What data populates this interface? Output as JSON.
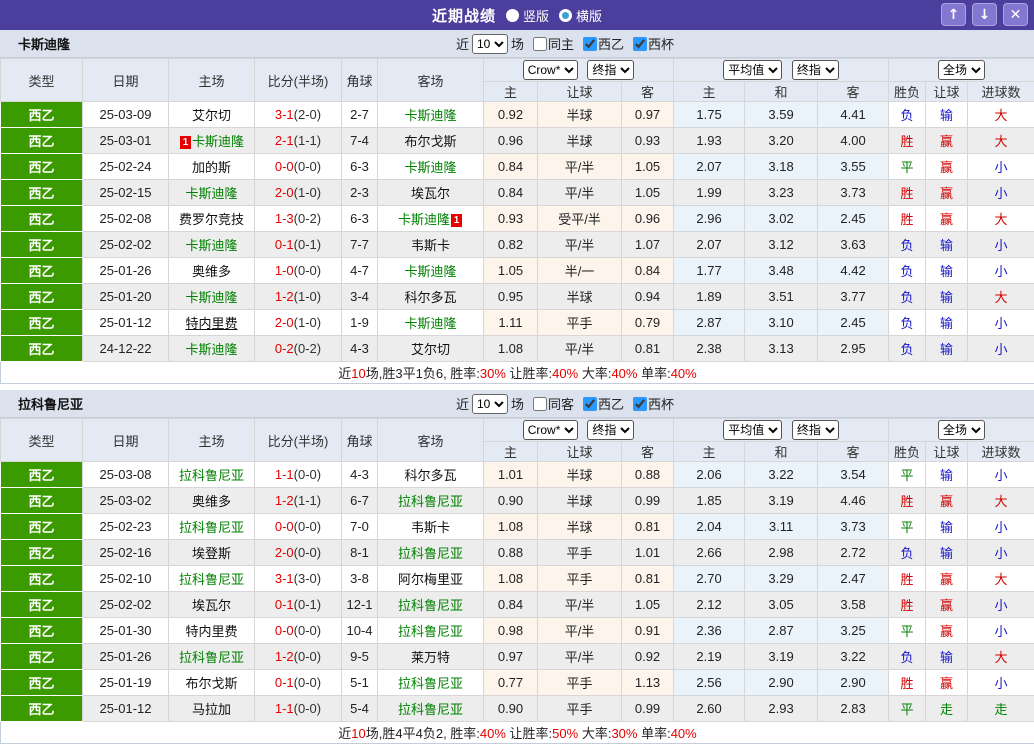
{
  "titlebar": {
    "title": "近期战绩",
    "vertical_label": "竖版",
    "horizontal_label": "横版",
    "vertical_selected": true,
    "up_glyph": "↑",
    "down_glyph": "↓",
    "close_glyph": "✕"
  },
  "colors": {
    "titlebar_purple": "#4b3e9c",
    "league_green": "#3a9a00",
    "team_green": "#008000",
    "score_red": "#e60000",
    "win_red": "#d00000",
    "lose_blue": "#1414c8",
    "draw_green": "#008000",
    "odds_bg": "#fdf5ec",
    "avg_bg": "#e9f3f9"
  },
  "columns": {
    "type": "类型",
    "date": "日期",
    "home": "主场",
    "score": "比分(半场)",
    "corner": "角球",
    "away": "客场",
    "crow_select": "Crow*",
    "final_select": "终指",
    "avg_select": "平均值",
    "final_select2": "终指",
    "full_select": "全场",
    "h": "主",
    "handicap": "让球",
    "a": "客",
    "avg_h": "主",
    "avg_d": "和",
    "avg_a": "客",
    "wl": "胜负",
    "hcap_res": "让球",
    "goals": "进球数"
  },
  "sections": [
    {
      "team": "卡斯迪隆",
      "filter": {
        "near": "近",
        "count": "10",
        "games": "场",
        "same": "同主",
        "same_checked": false,
        "league": "西乙",
        "league_checked": true,
        "cup": "西杯",
        "cup_checked": true
      },
      "rows": [
        {
          "league": "西乙",
          "date": "25-03-09",
          "home": {
            "name": "艾尔切"
          },
          "score": "3-1",
          "half": "(2-0)",
          "corner": "2-7",
          "away": {
            "name": "卡斯迪隆",
            "green": true
          },
          "odds": [
            "0.92",
            "半球",
            "0.97"
          ],
          "avg": [
            "1.75",
            "3.59",
            "4.41"
          ],
          "results": [
            [
              "负",
              "b"
            ],
            [
              "输",
              "b"
            ],
            [
              "大",
              "r"
            ]
          ]
        },
        {
          "league": "西乙",
          "date": "25-03-01",
          "home": {
            "name": "卡斯迪隆",
            "green": true,
            "badge": "1",
            "badge_pos": "before"
          },
          "score": "2-1",
          "half": "(1-1)",
          "corner": "7-4",
          "away": {
            "name": "布尔戈斯"
          },
          "odds": [
            "0.96",
            "半球",
            "0.93"
          ],
          "avg": [
            "1.93",
            "3.20",
            "4.00"
          ],
          "results": [
            [
              "胜",
              "r"
            ],
            [
              "赢",
              "r"
            ],
            [
              "大",
              "r"
            ]
          ]
        },
        {
          "league": "西乙",
          "date": "25-02-24",
          "home": {
            "name": "加的斯"
          },
          "score": "0-0",
          "half": "(0-0)",
          "corner": "6-3",
          "away": {
            "name": "卡斯迪隆",
            "green": true
          },
          "odds": [
            "0.84",
            "平/半",
            "1.05"
          ],
          "avg": [
            "2.07",
            "3.18",
            "3.55"
          ],
          "results": [
            [
              "平",
              "g"
            ],
            [
              "赢",
              "r"
            ],
            [
              "小",
              "b"
            ]
          ]
        },
        {
          "league": "西乙",
          "date": "25-02-15",
          "home": {
            "name": "卡斯迪隆",
            "green": true
          },
          "score": "2-0",
          "half": "(1-0)",
          "corner": "2-3",
          "away": {
            "name": "埃瓦尔"
          },
          "odds": [
            "0.84",
            "平/半",
            "1.05"
          ],
          "avg": [
            "1.99",
            "3.23",
            "3.73"
          ],
          "results": [
            [
              "胜",
              "r"
            ],
            [
              "赢",
              "r"
            ],
            [
              "小",
              "b"
            ]
          ]
        },
        {
          "league": "西乙",
          "date": "25-02-08",
          "home": {
            "name": "费罗尔竞技"
          },
          "score": "1-3",
          "half": "(0-2)",
          "corner": "6-3",
          "away": {
            "name": "卡斯迪隆",
            "green": true,
            "badge": "1",
            "badge_pos": "after"
          },
          "odds": [
            "0.93",
            "受平/半",
            "0.96"
          ],
          "avg": [
            "2.96",
            "3.02",
            "2.45"
          ],
          "results": [
            [
              "胜",
              "r"
            ],
            [
              "赢",
              "r"
            ],
            [
              "大",
              "r"
            ]
          ]
        },
        {
          "league": "西乙",
          "date": "25-02-02",
          "home": {
            "name": "卡斯迪隆",
            "green": true
          },
          "score": "0-1",
          "half": "(0-1)",
          "corner": "7-7",
          "away": {
            "name": "韦斯卡"
          },
          "odds": [
            "0.82",
            "平/半",
            "1.07"
          ],
          "avg": [
            "2.07",
            "3.12",
            "3.63"
          ],
          "results": [
            [
              "负",
              "b"
            ],
            [
              "输",
              "b"
            ],
            [
              "小",
              "b"
            ]
          ]
        },
        {
          "league": "西乙",
          "date": "25-01-26",
          "home": {
            "name": "奥维多"
          },
          "score": "1-0",
          "half": "(0-0)",
          "corner": "4-7",
          "away": {
            "name": "卡斯迪隆",
            "green": true
          },
          "odds": [
            "1.05",
            "半/一",
            "0.84"
          ],
          "avg": [
            "1.77",
            "3.48",
            "4.42"
          ],
          "results": [
            [
              "负",
              "b"
            ],
            [
              "输",
              "b"
            ],
            [
              "小",
              "b"
            ]
          ]
        },
        {
          "league": "西乙",
          "date": "25-01-20",
          "home": {
            "name": "卡斯迪隆",
            "green": true
          },
          "score": "1-2",
          "half": "(1-0)",
          "corner": "3-4",
          "away": {
            "name": "科尔多瓦"
          },
          "odds": [
            "0.95",
            "半球",
            "0.94"
          ],
          "avg": [
            "1.89",
            "3.51",
            "3.77"
          ],
          "results": [
            [
              "负",
              "b"
            ],
            [
              "输",
              "b"
            ],
            [
              "大",
              "r"
            ]
          ]
        },
        {
          "league": "西乙",
          "date": "25-01-12",
          "home": {
            "name": "特内里费",
            "underline": true
          },
          "score": "2-0",
          "half": "(1-0)",
          "corner": "1-9",
          "away": {
            "name": "卡斯迪隆",
            "green": true
          },
          "odds": [
            "1.11",
            "平手",
            "0.79"
          ],
          "avg": [
            "2.87",
            "3.10",
            "2.45"
          ],
          "results": [
            [
              "负",
              "b"
            ],
            [
              "输",
              "b"
            ],
            [
              "小",
              "b"
            ]
          ]
        },
        {
          "league": "西乙",
          "date": "24-12-22",
          "home": {
            "name": "卡斯迪隆",
            "green": true
          },
          "score": "0-2",
          "half": "(0-2)",
          "corner": "4-3",
          "away": {
            "name": "艾尔切"
          },
          "odds": [
            "1.08",
            "平/半",
            "0.81"
          ],
          "avg": [
            "2.38",
            "3.13",
            "2.95"
          ],
          "results": [
            [
              "负",
              "b"
            ],
            [
              "输",
              "b"
            ],
            [
              "小",
              "b"
            ]
          ]
        }
      ],
      "summary": [
        {
          "t": "近"
        },
        {
          "t": "10",
          "r": true
        },
        {
          "t": "场,胜3平1负6, 胜率:"
        },
        {
          "t": "30%",
          "r": true
        },
        {
          "t": " 让胜率:"
        },
        {
          "t": "40%",
          "r": true
        },
        {
          "t": " 大率:"
        },
        {
          "t": "40%",
          "r": true
        },
        {
          "t": " 单率:"
        },
        {
          "t": "40%",
          "r": true
        }
      ]
    },
    {
      "team": "拉科鲁尼亚",
      "filter": {
        "near": "近",
        "count": "10",
        "games": "场",
        "same": "同客",
        "same_checked": false,
        "league": "西乙",
        "league_checked": true,
        "cup": "西杯",
        "cup_checked": true
      },
      "rows": [
        {
          "league": "西乙",
          "date": "25-03-08",
          "home": {
            "name": "拉科鲁尼亚",
            "green": true
          },
          "score": "1-1",
          "half": "(0-0)",
          "corner": "4-3",
          "away": {
            "name": "科尔多瓦"
          },
          "odds": [
            "1.01",
            "半球",
            "0.88"
          ],
          "avg": [
            "2.06",
            "3.22",
            "3.54"
          ],
          "results": [
            [
              "平",
              "g"
            ],
            [
              "输",
              "b"
            ],
            [
              "小",
              "b"
            ]
          ]
        },
        {
          "league": "西乙",
          "date": "25-03-02",
          "home": {
            "name": "奥维多"
          },
          "score": "1-2",
          "half": "(1-1)",
          "corner": "6-7",
          "away": {
            "name": "拉科鲁尼亚",
            "green": true
          },
          "odds": [
            "0.90",
            "半球",
            "0.99"
          ],
          "avg": [
            "1.85",
            "3.19",
            "4.46"
          ],
          "results": [
            [
              "胜",
              "r"
            ],
            [
              "赢",
              "r"
            ],
            [
              "大",
              "r"
            ]
          ]
        },
        {
          "league": "西乙",
          "date": "25-02-23",
          "home": {
            "name": "拉科鲁尼亚",
            "green": true
          },
          "score": "0-0",
          "half": "(0-0)",
          "corner": "7-0",
          "away": {
            "name": "韦斯卡"
          },
          "odds": [
            "1.08",
            "半球",
            "0.81"
          ],
          "avg": [
            "2.04",
            "3.11",
            "3.73"
          ],
          "results": [
            [
              "平",
              "g"
            ],
            [
              "输",
              "b"
            ],
            [
              "小",
              "b"
            ]
          ]
        },
        {
          "league": "西乙",
          "date": "25-02-16",
          "home": {
            "name": "埃登斯"
          },
          "score": "2-0",
          "half": "(0-0)",
          "corner": "8-1",
          "away": {
            "name": "拉科鲁尼亚",
            "green": true
          },
          "odds": [
            "0.88",
            "平手",
            "1.01"
          ],
          "avg": [
            "2.66",
            "2.98",
            "2.72"
          ],
          "results": [
            [
              "负",
              "b"
            ],
            [
              "输",
              "b"
            ],
            [
              "小",
              "b"
            ]
          ]
        },
        {
          "league": "西乙",
          "date": "25-02-10",
          "home": {
            "name": "拉科鲁尼亚",
            "green": true
          },
          "score": "3-1",
          "half": "(3-0)",
          "corner": "3-8",
          "away": {
            "name": "阿尔梅里亚"
          },
          "odds": [
            "1.08",
            "平手",
            "0.81"
          ],
          "avg": [
            "2.70",
            "3.29",
            "2.47"
          ],
          "results": [
            [
              "胜",
              "r"
            ],
            [
              "赢",
              "r"
            ],
            [
              "大",
              "r"
            ]
          ]
        },
        {
          "league": "西乙",
          "date": "25-02-02",
          "home": {
            "name": "埃瓦尔"
          },
          "score": "0-1",
          "half": "(0-1)",
          "corner": "12-1",
          "away": {
            "name": "拉科鲁尼亚",
            "green": true
          },
          "odds": [
            "0.84",
            "平/半",
            "1.05"
          ],
          "avg": [
            "2.12",
            "3.05",
            "3.58"
          ],
          "results": [
            [
              "胜",
              "r"
            ],
            [
              "赢",
              "r"
            ],
            [
              "小",
              "b"
            ]
          ]
        },
        {
          "league": "西乙",
          "date": "25-01-30",
          "home": {
            "name": "特内里费"
          },
          "score": "0-0",
          "half": "(0-0)",
          "corner": "10-4",
          "away": {
            "name": "拉科鲁尼亚",
            "green": true
          },
          "odds": [
            "0.98",
            "平/半",
            "0.91"
          ],
          "avg": [
            "2.36",
            "2.87",
            "3.25"
          ],
          "results": [
            [
              "平",
              "g"
            ],
            [
              "赢",
              "r"
            ],
            [
              "小",
              "b"
            ]
          ]
        },
        {
          "league": "西乙",
          "date": "25-01-26",
          "home": {
            "name": "拉科鲁尼亚",
            "green": true
          },
          "score": "1-2",
          "half": "(0-0)",
          "corner": "9-5",
          "away": {
            "name": "莱万特"
          },
          "odds": [
            "0.97",
            "平/半",
            "0.92"
          ],
          "avg": [
            "2.19",
            "3.19",
            "3.22"
          ],
          "results": [
            [
              "负",
              "b"
            ],
            [
              "输",
              "b"
            ],
            [
              "大",
              "r"
            ]
          ]
        },
        {
          "league": "西乙",
          "date": "25-01-19",
          "home": {
            "name": "布尔戈斯"
          },
          "score": "0-1",
          "half": "(0-0)",
          "corner": "5-1",
          "away": {
            "name": "拉科鲁尼亚",
            "green": true
          },
          "odds": [
            "0.77",
            "平手",
            "1.13"
          ],
          "avg": [
            "2.56",
            "2.90",
            "2.90"
          ],
          "results": [
            [
              "胜",
              "r"
            ],
            [
              "赢",
              "r"
            ],
            [
              "小",
              "b"
            ]
          ]
        },
        {
          "league": "西乙",
          "date": "25-01-12",
          "home": {
            "name": "马拉加"
          },
          "score": "1-1",
          "half": "(0-0)",
          "corner": "5-4",
          "away": {
            "name": "拉科鲁尼亚",
            "green": true
          },
          "odds": [
            "0.90",
            "平手",
            "0.99"
          ],
          "avg": [
            "2.60",
            "2.93",
            "2.83"
          ],
          "results": [
            [
              "平",
              "g"
            ],
            [
              "走",
              "g"
            ],
            [
              "走",
              "g"
            ]
          ]
        }
      ],
      "summary": [
        {
          "t": "近"
        },
        {
          "t": "10",
          "r": true
        },
        {
          "t": "场,胜4平4负2, 胜率:"
        },
        {
          "t": "40%",
          "r": true
        },
        {
          "t": " 让胜率:"
        },
        {
          "t": "50%",
          "r": true
        },
        {
          "t": " 大率:"
        },
        {
          "t": "30%",
          "r": true
        },
        {
          "t": " 单率:"
        },
        {
          "t": "40%",
          "r": true
        }
      ]
    }
  ]
}
